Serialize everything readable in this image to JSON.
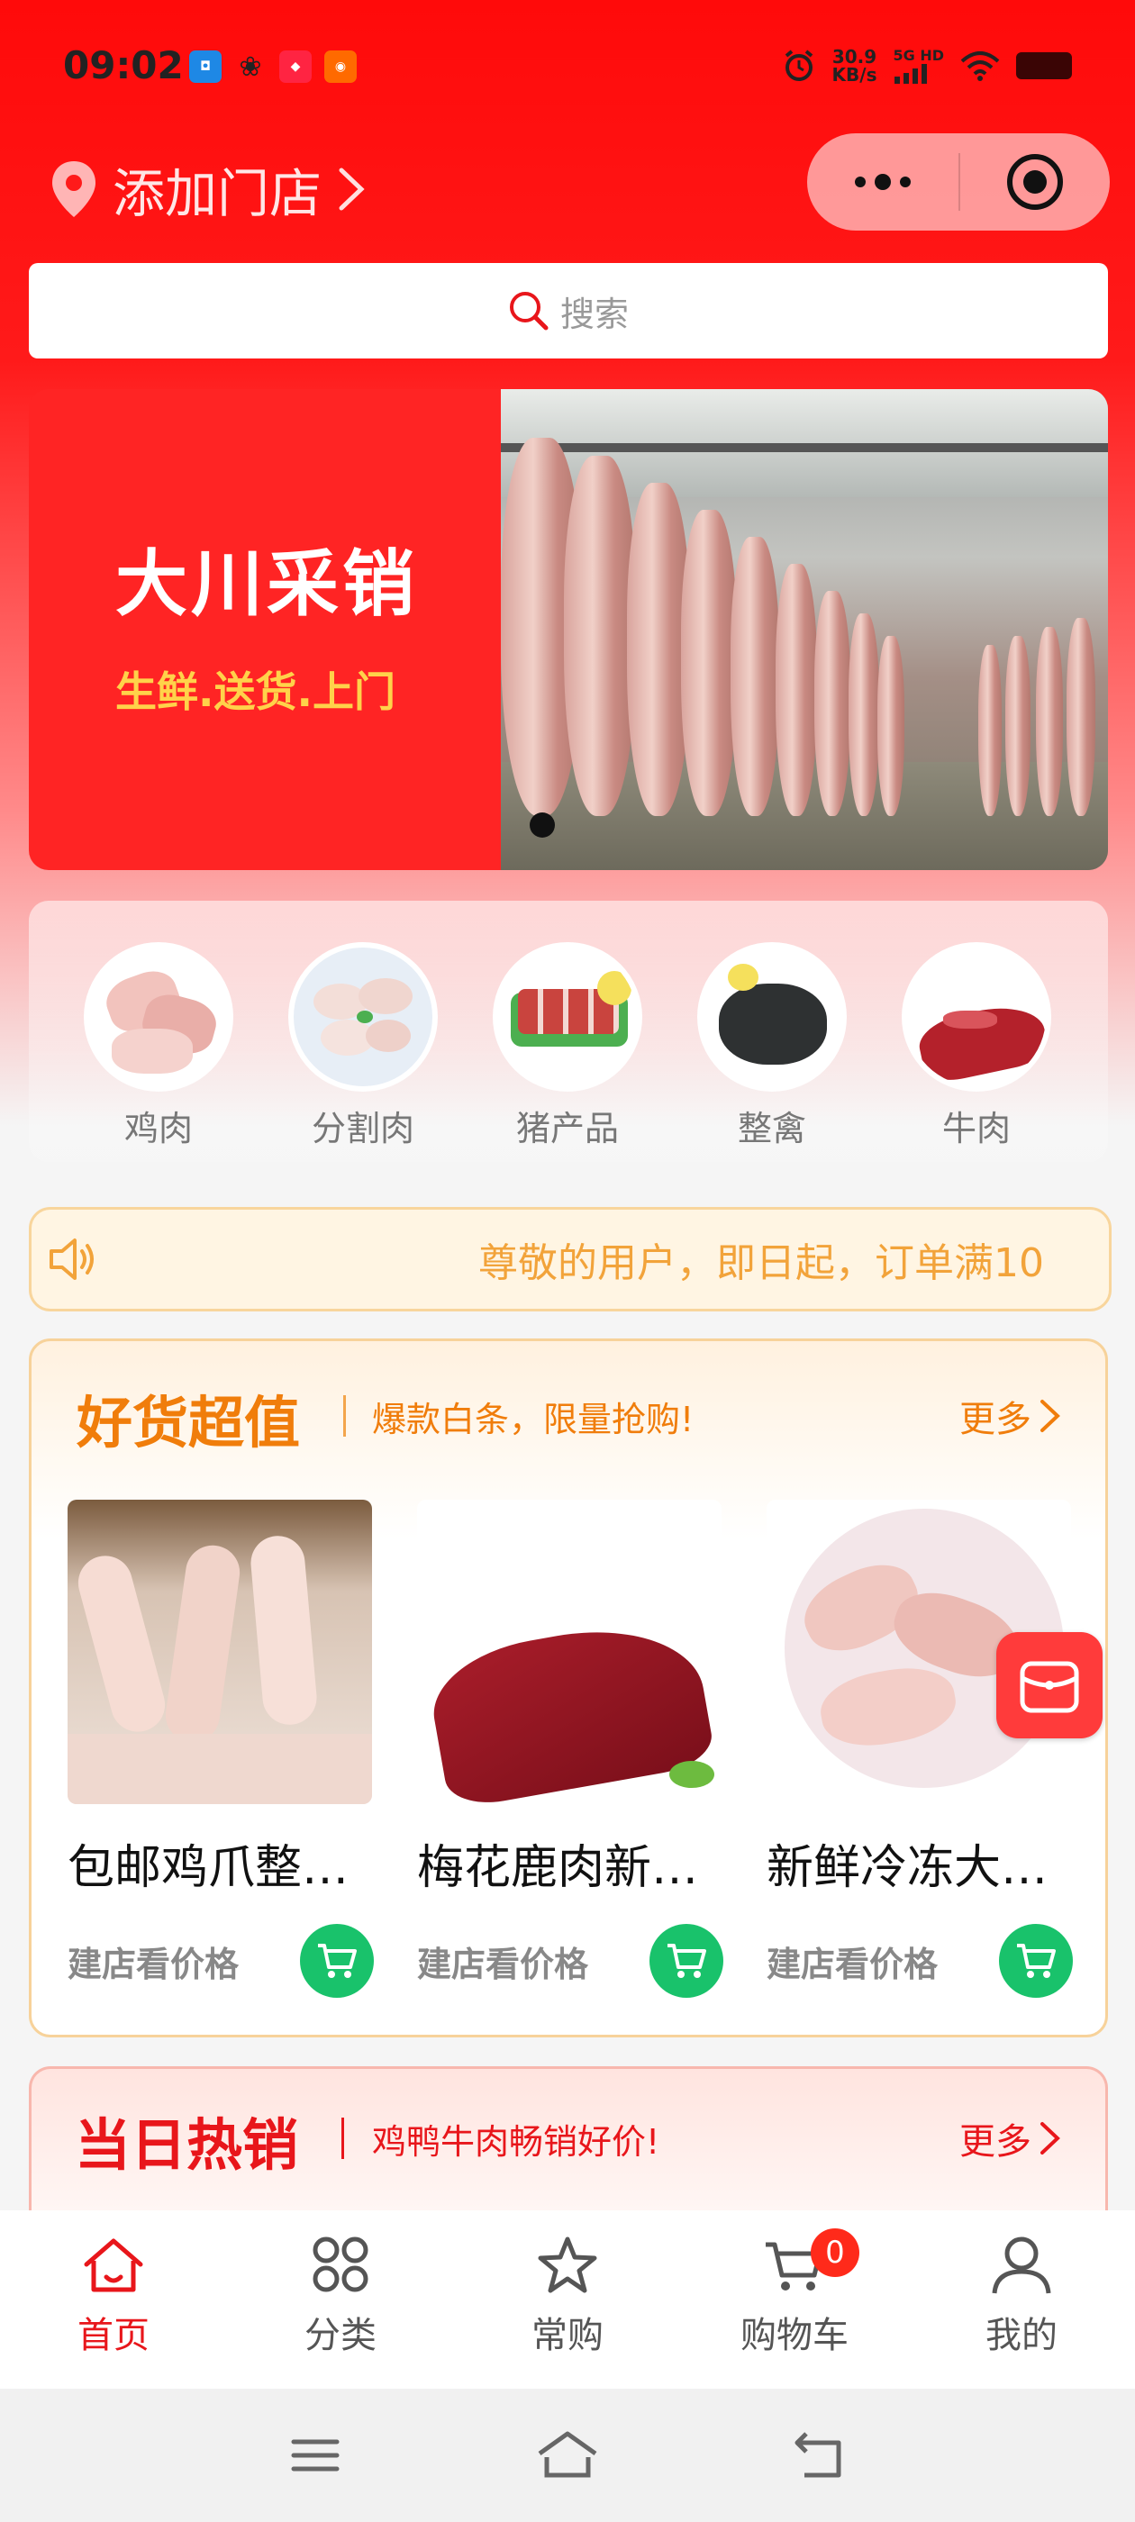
{
  "status_bar": {
    "time": "09:02",
    "net_speed_value": "30.9",
    "net_speed_unit": "KB/s",
    "network": "5G HD"
  },
  "header": {
    "store_label": "添加门店"
  },
  "search": {
    "placeholder": "搜索"
  },
  "banner": {
    "title": "大川采销",
    "subtitle": "生鲜.送货.上门"
  },
  "categories": [
    {
      "label": "鸡肉"
    },
    {
      "label": "分割肉"
    },
    {
      "label": "猪产品"
    },
    {
      "label": "整禽"
    },
    {
      "label": "牛肉"
    }
  ],
  "notice": {
    "text": "尊敬的用户，即日起，订单满10"
  },
  "good_deals": {
    "title": "好货超值",
    "subtitle": "爆款白条，限量抢购!",
    "more_label": "更多",
    "products": [
      {
        "name": "包邮鸡爪整…",
        "price_label": "建店看价格"
      },
      {
        "name": "梅花鹿肉新…",
        "price_label": "建店看价格"
      },
      {
        "name": "新鲜冷冻大…",
        "price_label": "建店看价格"
      }
    ]
  },
  "hot_today": {
    "title": "当日热销",
    "subtitle": "鸡鸭牛肉畅销好价!",
    "more_label": "更多"
  },
  "tabbar": {
    "tabs": [
      {
        "label": "首页",
        "icon": "home-icon",
        "active": true
      },
      {
        "label": "分类",
        "icon": "grid-icon"
      },
      {
        "label": "常购",
        "icon": "star-icon"
      },
      {
        "label": "购物车",
        "icon": "cart-icon",
        "badge": "0"
      },
      {
        "label": "我的",
        "icon": "user-icon"
      }
    ]
  },
  "colors": {
    "brand_red": "#ff0a0a",
    "accent_orange": "#f07d0b",
    "cart_green": "#19c26b",
    "hot_red": "#e8161b"
  }
}
